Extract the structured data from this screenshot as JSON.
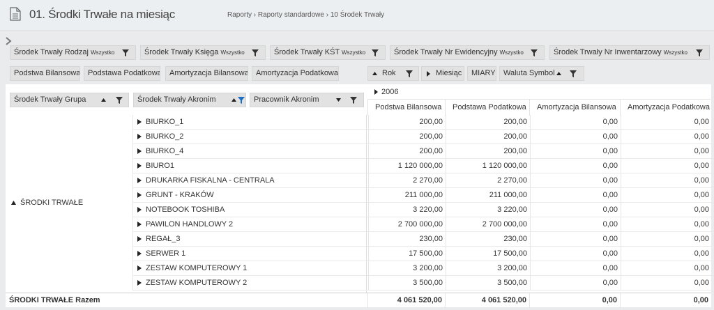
{
  "header": {
    "title": "01. Środki Trwałe na miesiąc",
    "breadcrumb": "Raporty  ›  Raporty standardowe  ›  10 Środek Trwały"
  },
  "filters": [
    {
      "label": "Środek Trwały Rodzaj",
      "value": "Wszystko"
    },
    {
      "label": "Środek Trwały Księga",
      "value": "Wszystko"
    },
    {
      "label": "Środek Trwały KŚT",
      "value": "Wszystko"
    },
    {
      "label": "Środek Trwały Nr Ewidencyjny",
      "value": "Wszystko"
    },
    {
      "label": "Środek Trwały Nr Inwentarzowy",
      "value": "Wszystko"
    }
  ],
  "data_fields": [
    "Podstwa Bilansowa",
    "Podstawa Podatkowa",
    "Amortyzacja Bilansowa",
    "Amortyzacja Podatkowa"
  ],
  "column_fields": {
    "rok": "Rok",
    "miesiac": "Miesiąc",
    "miary": "MIARY",
    "waluta": "Waluta Symbol"
  },
  "row_fields": {
    "grupa": "Środek Trwały Grupa",
    "akronim": "Środek Trwały Akronim",
    "pracownik": "Pracownik Akronim"
  },
  "grid": {
    "year": "2006",
    "columns": [
      "Podstwa Bilansowa",
      "Podstawa Podatkowa",
      "Amortyzacja Bilansowa",
      "Amortyzacja Podatkowa"
    ],
    "group": "ŚRODKI TRWAŁE",
    "rows": [
      {
        "name": "BIURKO_1",
        "values": [
          "200,00",
          "200,00",
          "0,00",
          "0,00"
        ]
      },
      {
        "name": "BIURKO_2",
        "values": [
          "200,00",
          "200,00",
          "0,00",
          "0,00"
        ]
      },
      {
        "name": "BIURKO_4",
        "values": [
          "200,00",
          "200,00",
          "0,00",
          "0,00"
        ]
      },
      {
        "name": "BIURO1",
        "values": [
          "1 120 000,00",
          "1 120 000,00",
          "0,00",
          "0,00"
        ]
      },
      {
        "name": "DRUKARKA FISKALNA - CENTRALA",
        "values": [
          "2 270,00",
          "2 270,00",
          "0,00",
          "0,00"
        ]
      },
      {
        "name": "GRUNT - KRAKÓW",
        "values": [
          "211 000,00",
          "211 000,00",
          "0,00",
          "0,00"
        ]
      },
      {
        "name": "NOTEBOOK TOSHIBA",
        "values": [
          "3 220,00",
          "3 220,00",
          "0,00",
          "0,00"
        ]
      },
      {
        "name": "PAWILON HANDLOWY 2",
        "values": [
          "2 700 000,00",
          "2 700 000,00",
          "0,00",
          "0,00"
        ]
      },
      {
        "name": "REGAŁ_3",
        "values": [
          "230,00",
          "230,00",
          "0,00",
          "0,00"
        ]
      },
      {
        "name": "SERWER 1",
        "values": [
          "17 500,00",
          "17 500,00",
          "0,00",
          "0,00"
        ]
      },
      {
        "name": "ZESTAW KOMPUTEROWY 1",
        "values": [
          "3 200,00",
          "3 200,00",
          "0,00",
          "0,00"
        ]
      },
      {
        "name": "ZESTAW KOMPUTEROWY 2",
        "values": [
          "3 500,00",
          "3 500,00",
          "0,00",
          "0,00"
        ]
      }
    ],
    "total_label": "ŚRODKI TRWAŁE Razem",
    "totals": [
      "4 061 520,00",
      "4 061 520,00",
      "0,00",
      "0,00"
    ]
  },
  "colors": {
    "topbar": "#eceff1",
    "chip": "#e2e2e2",
    "filter_active": "#1a6fc4"
  }
}
